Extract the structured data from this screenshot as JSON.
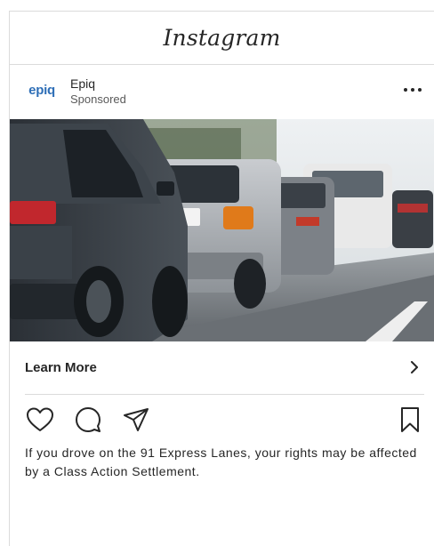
{
  "app": {
    "logo_text": "Instagram"
  },
  "post": {
    "account_logo_text": "epiq",
    "account_name": "Epiq",
    "account_subtitle": "Sponsored",
    "more_icon": "more-horizontal-icon",
    "image_description_icon": "car-traffic-photo",
    "cta_label": "Learn More",
    "cta_icon": "chevron-right-icon",
    "actions": [
      {
        "name": "like",
        "icon": "heart-icon"
      },
      {
        "name": "comment",
        "icon": "comment-icon"
      },
      {
        "name": "share",
        "icon": "paper-plane-icon"
      },
      {
        "name": "save",
        "icon": "bookmark-icon"
      }
    ],
    "caption": "If you drove on the 91 Express Lanes, your rights may be affected by a Class Action Settlement."
  },
  "colors": {
    "brand": "#2f6fb7",
    "border": "#dbdbdb",
    "text": "#262626"
  }
}
